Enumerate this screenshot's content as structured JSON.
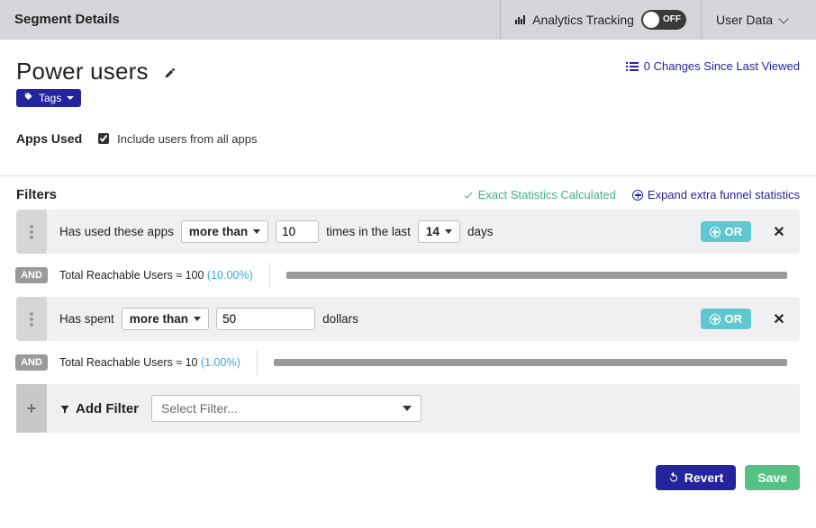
{
  "topbar": {
    "title": "Segment Details",
    "analytics_label": "Analytics Tracking",
    "toggle_state": "OFF",
    "userdata_label": "User Data"
  },
  "segment": {
    "name": "Power users",
    "changes_text": "0 Changes Since Last Viewed",
    "tags_label": "Tags"
  },
  "apps_used": {
    "label": "Apps Used",
    "include_label": "Include users from all apps",
    "include_checked": true
  },
  "filters": {
    "title": "Filters",
    "exact_stats": "Exact Statistics Calculated",
    "expand": "Expand extra funnel statistics",
    "groups": [
      {
        "prefix": "Has used these apps",
        "comparator": "more than",
        "value": "10",
        "mid1": "times in the last",
        "value2": "14",
        "suffix": "days",
        "or_label": "OR",
        "reach_prefix": "Total Reachable Users ≈ ",
        "reach_value": "100",
        "reach_pct": "(10.00%)"
      },
      {
        "prefix": "Has spent",
        "comparator": "more than",
        "value": "50",
        "suffix": "dollars",
        "or_label": "OR",
        "reach_prefix": "Total Reachable Users ≈ ",
        "reach_value": "10",
        "reach_pct": "(1.00%)"
      }
    ],
    "and_label": "AND",
    "add_filter_label": "Add Filter",
    "select_filter_placeholder": "Select Filter..."
  },
  "footer": {
    "revert": "Revert",
    "save": "Save"
  }
}
